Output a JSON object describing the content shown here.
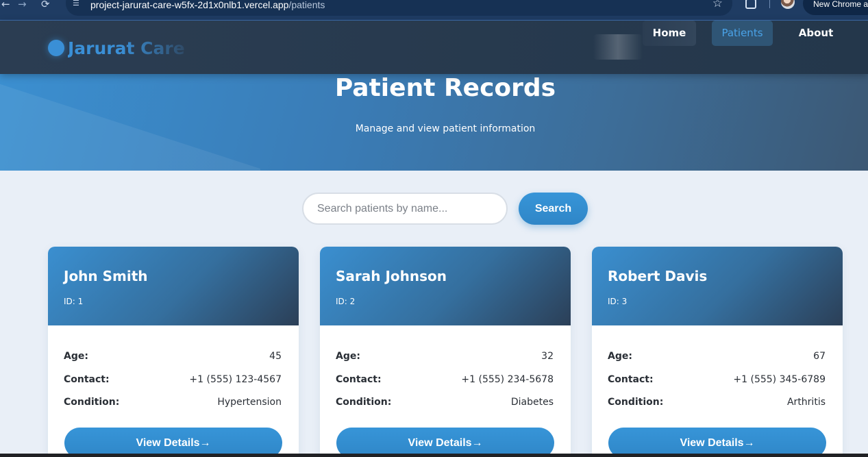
{
  "browser": {
    "url_host": "project-jarurat-care-w5fx-2d1x0nlb1.vercel.app",
    "url_path": "/patients",
    "new_chrome_label": "New Chrome av"
  },
  "header": {
    "brand": "Jarurat Care",
    "nav": {
      "home": "Home",
      "patients": "Patients",
      "about": "About"
    },
    "active_nav": "patients"
  },
  "hero": {
    "title": "Patient Records",
    "subtitle": "Manage and view patient information"
  },
  "search": {
    "placeholder": "Search patients by name...",
    "button_label": "Search"
  },
  "labels": {
    "age": "Age:",
    "contact": "Contact:",
    "condition": "Condition:",
    "view_details": "View Details→"
  },
  "patients": [
    {
      "name": "John Smith",
      "id_text": "ID: 1",
      "age": "45",
      "contact": "+1 (555) 123-4567",
      "condition": "Hypertension"
    },
    {
      "name": "Sarah Johnson",
      "id_text": "ID: 2",
      "age": "32",
      "contact": "+1 (555) 234-5678",
      "condition": "Diabetes"
    },
    {
      "name": "Robert Davis",
      "id_text": "ID: 3",
      "age": "67",
      "contact": "+1 (555) 345-6789",
      "condition": "Arthritis"
    }
  ],
  "colors": {
    "accent": "#3795d8",
    "header_bg": "#2b3d52",
    "active_nav_text": "#4aa3e8"
  }
}
